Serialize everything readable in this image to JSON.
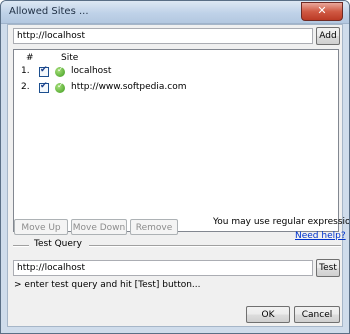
{
  "window": {
    "title": "Allowed Sites ...",
    "close_glyph": "✕"
  },
  "url_input": {
    "value": "http://localhost"
  },
  "add_button": "Add",
  "list": {
    "headers": {
      "num": "#",
      "site": "Site"
    },
    "rows": [
      {
        "num": "1.",
        "site": "localhost",
        "checked": true
      },
      {
        "num": "2.",
        "site": "http://www.softpedia.com",
        "checked": true
      }
    ]
  },
  "actions": {
    "move_up": "Move Up",
    "move_down": "Move Down",
    "remove": "Remove"
  },
  "regex_note": "You may use regular expressions!",
  "help_link": "Need help?",
  "test_query": {
    "label": "Test Query",
    "value": "http://localhost",
    "button": "Test",
    "result": "> enter test query and hit [Test] button..."
  },
  "footer": {
    "ok": "OK",
    "cancel": "Cancel"
  }
}
